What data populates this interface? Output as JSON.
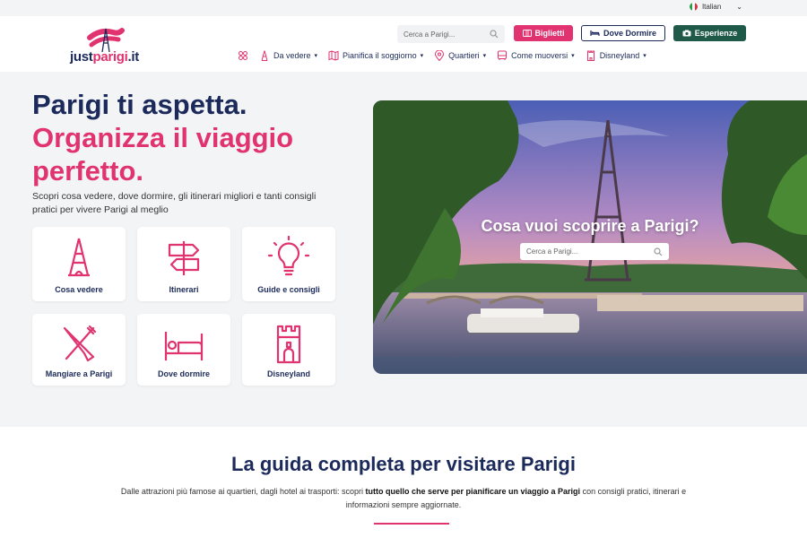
{
  "language": {
    "label": "Italian"
  },
  "logo": {
    "part1": "just",
    "part2": "parigi",
    "part3": ".it"
  },
  "header": {
    "search_placeholder": "Cerca a Parigi...",
    "btn_tickets": "Biglietti",
    "btn_sleep": "Dove Dormire",
    "btn_experiences": "Esperienze"
  },
  "nav": {
    "items": [
      {
        "label": "Da vedere"
      },
      {
        "label": "Pianifica il soggiorno"
      },
      {
        "label": "Quartieri"
      },
      {
        "label": "Come muoversi"
      },
      {
        "label": "Disneyland"
      }
    ]
  },
  "hero": {
    "title_line1": "Parigi ti aspetta.",
    "title_line2": "Organizza il viaggio perfetto.",
    "subtitle": "Scopri cosa vedere, dove dormire, gli itinerari migliori e tanti consigli pratici per vivere Parigi al meglio",
    "image_question": "Cosa vuoi scoprire a Parigi?",
    "image_search_placeholder": "Cerca a Parigi..."
  },
  "cards": [
    {
      "label": "Cosa vedere",
      "icon": "eiffel-tower-icon"
    },
    {
      "label": "Itinerari",
      "icon": "signpost-icon"
    },
    {
      "label": "Guide e consigli",
      "icon": "lightbulb-icon"
    },
    {
      "label": "Mangiare a Parigi",
      "icon": "cutlery-icon"
    },
    {
      "label": "Dove dormire",
      "icon": "bed-icon"
    },
    {
      "label": "Disneyland",
      "icon": "castle-tower-icon"
    }
  ],
  "guide": {
    "title": "La guida completa per visitare Parigi",
    "sub_part1": "Dalle attrazioni più famose ai quartieri, dagli hotel ai trasporti: scopri ",
    "sub_bold": "tutto quello che serve per pianificare un viaggio a Parigi",
    "sub_part2": " con consigli pratici, itinerari e informazioni sempre aggiornate."
  },
  "colors": {
    "brand_pink": "#e0336f",
    "navy": "#1b2a5a",
    "green": "#1f5a48"
  }
}
